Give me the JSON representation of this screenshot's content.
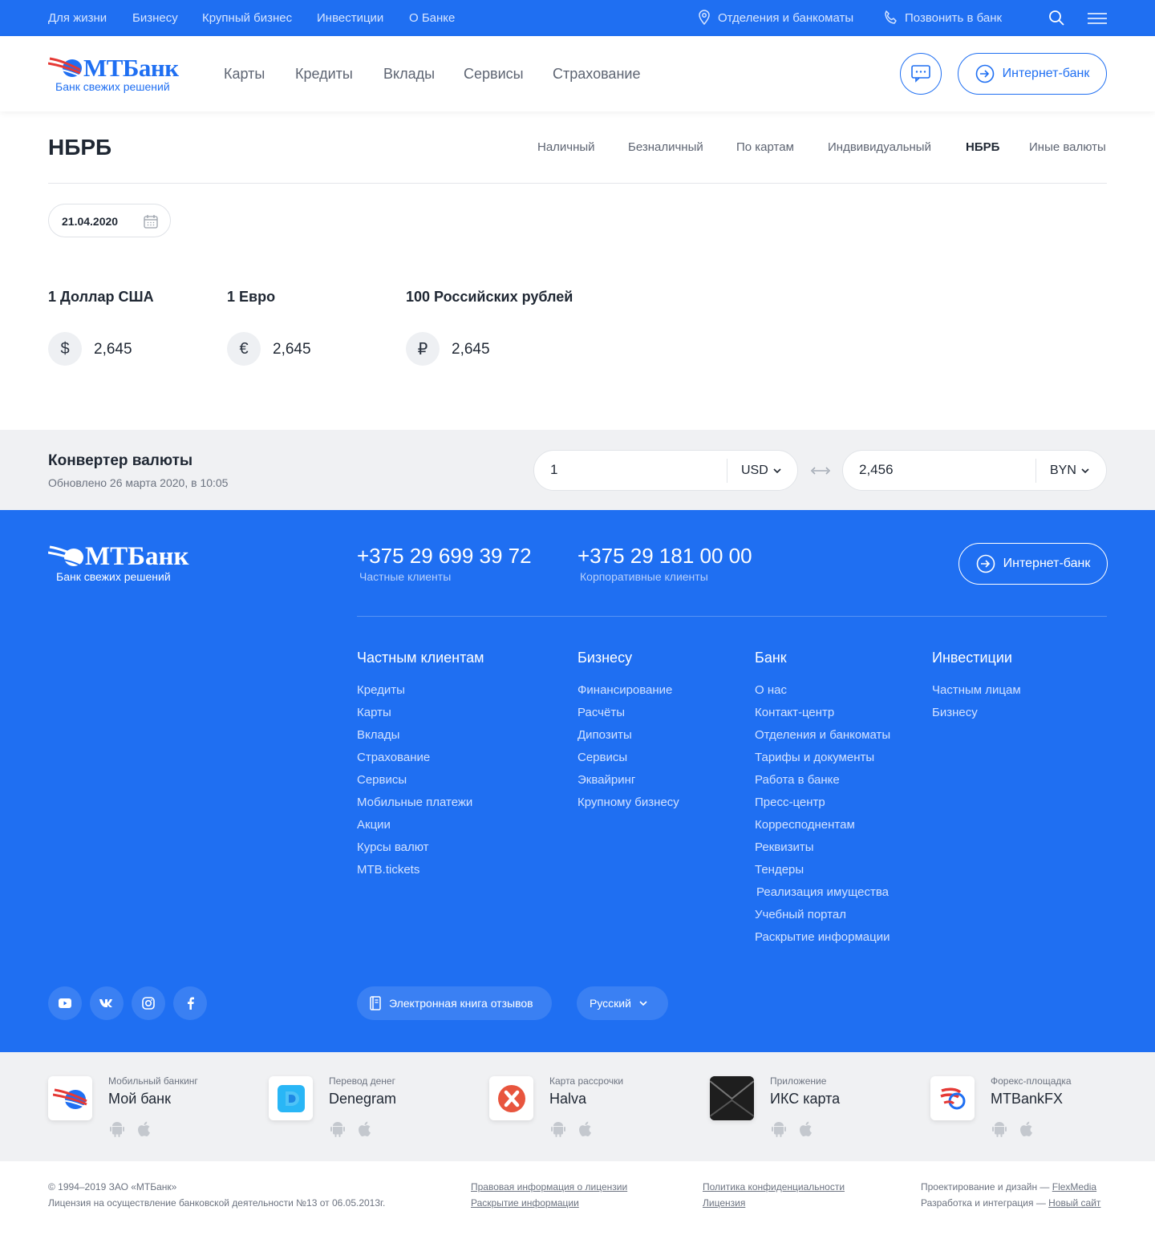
{
  "topbar": {
    "links": [
      "Для жизни",
      "Бизнесу",
      "Крупный бизнес",
      "Инвестиции",
      "О Банке"
    ],
    "branches": "Отделения и банкоматы",
    "call": "Позвонить в банк"
  },
  "logo": {
    "name": "МТБанк",
    "slogan": "Банк свежих решений"
  },
  "nav": [
    "Карты",
    "Кредиты",
    "Вклады",
    "Сервисы",
    "Страхование"
  ],
  "header": {
    "internet_bank": "Интернет-банк"
  },
  "page": {
    "title": "НБРБ",
    "tabs": [
      "Наличный",
      "Безналичный",
      "По картам",
      "Индвивидуальный",
      "НБРБ",
      "Иные валюты"
    ],
    "active_tab": "НБРБ",
    "date": "21.04.2020"
  },
  "rates": [
    {
      "title": "1 Доллар США",
      "symbol": "$",
      "value": "2,645"
    },
    {
      "title": "1 Евро",
      "symbol": "€",
      "value": "2,645"
    },
    {
      "title": "100 Российских рублей",
      "symbol": "₽",
      "value": "2,645"
    }
  ],
  "converter": {
    "title": "Конвертер валюты",
    "updated": "Обновлено 26 марта 2020, в 10:05",
    "from_value": "1",
    "from_currency": "USD",
    "to_value": "2,456",
    "to_currency": "BYN"
  },
  "footer": {
    "phones": [
      {
        "number": "+375 29 699 39 72",
        "label": "Частные клиенты"
      },
      {
        "number": "+375 29 181 00 00",
        "label": "Корпоративные клиенты"
      }
    ],
    "internet_bank": "Интернет-банк",
    "columns": [
      {
        "title": "Частным клиентам",
        "links": [
          "Кредиты",
          "Карты",
          "Вклады",
          "Страхование",
          "Сервисы",
          "Мобильные платежи",
          "Акции",
          "Курсы валют",
          "MTB.tickets"
        ]
      },
      {
        "title": "Бизнесу",
        "links": [
          "Финансирование",
          "Расчёты",
          "Дипозиты",
          "Сервисы",
          "Эквайринг",
          "Крупному бизнесу"
        ]
      },
      {
        "title": "Банк",
        "links": [
          "О нас",
          "Контакт-центр",
          "Отделения и банкоматы",
          "Тарифы и документы",
          "Работа в банке",
          "Пресс-центр",
          "Корресподнентам",
          "Реквизиты",
          "Тендеры",
          "Реализация имущества",
          "Учебный портал",
          "Раскрытие информации"
        ]
      },
      {
        "title": "Инвестиции",
        "links": [
          "Частным лицам",
          "Бизнесу"
        ]
      }
    ],
    "social": [
      "youtube-icon",
      "vk-icon",
      "instagram-icon",
      "facebook-icon"
    ],
    "reviews": "Электронная книга отзывов",
    "language": "Русский"
  },
  "apps": [
    {
      "sub": "Мобильный банкинг",
      "name": "Мой банк"
    },
    {
      "sub": "Перевод денег",
      "name": "Denegram"
    },
    {
      "sub": "Карта рассрочки",
      "name": "Halva"
    },
    {
      "sub": "Приложение",
      "name": "ИКС карта"
    },
    {
      "sub": "Форекс-площадка",
      "name": "MTBankFX"
    }
  ],
  "bottom": {
    "copyright": "© 1994–2019 ЗАО «МТБанк»",
    "license_text": "Лицензия на осуществление банковской деятельности №13 от 06.05.2013г.",
    "legal": "Правовая информация о лицензии",
    "disclosure": "Раскрытие информации",
    "privacy": "Политика конфиденциальности",
    "license": "Лицензия",
    "design_prefix": "Проектирование и дизайн — ",
    "design_by": "FlexMedia",
    "dev_prefix": "Разработка и интеграция — ",
    "dev_by": "Новый сайт"
  },
  "colors": {
    "brand": "#1f6ff2",
    "bg_gray": "#f0f1f3",
    "text": "#1f2733"
  }
}
